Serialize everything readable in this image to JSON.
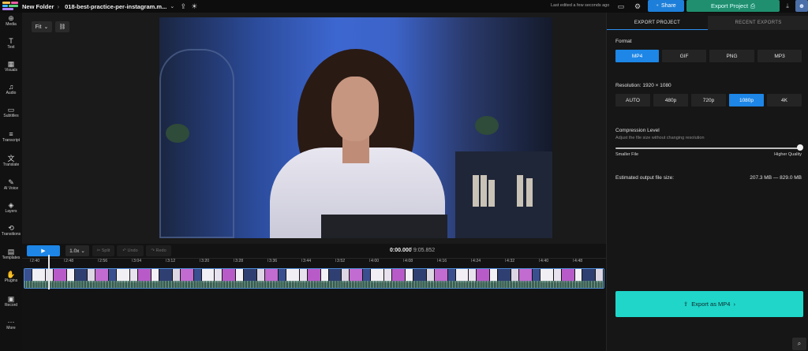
{
  "topbar": {
    "folder": "New Folder",
    "file": "018-best-practice-per-instagram.m...",
    "last_edited": "Last edited a few seconds ago",
    "share_label": "Share",
    "export_project_label": "Export Project"
  },
  "sidebar": {
    "items": [
      {
        "label": "Media",
        "icon": "media-icon",
        "glyph": "⊕"
      },
      {
        "label": "Text",
        "icon": "text-icon",
        "glyph": "T"
      },
      {
        "label": "Visuals",
        "icon": "visuals-icon",
        "glyph": "▦"
      },
      {
        "label": "Audio",
        "icon": "audio-icon",
        "glyph": "♫"
      },
      {
        "label": "Subtitles",
        "icon": "subtitles-icon",
        "glyph": "▭"
      },
      {
        "label": "Transcript",
        "icon": "transcript-icon",
        "glyph": "≡"
      },
      {
        "label": "Translate",
        "icon": "translate-icon",
        "glyph": "文"
      },
      {
        "label": "AI Voice",
        "icon": "ai-voice-icon",
        "glyph": "✎"
      },
      {
        "label": "Layers",
        "icon": "layers-icon",
        "glyph": "◈"
      },
      {
        "label": "Transitions",
        "icon": "transitions-icon",
        "glyph": "⟲"
      },
      {
        "label": "Templates",
        "icon": "templates-icon",
        "glyph": "▤"
      },
      {
        "label": "Plugins",
        "icon": "plugins-icon",
        "glyph": "✋"
      },
      {
        "label": "Record",
        "icon": "record-icon",
        "glyph": "▣"
      },
      {
        "label": "More",
        "icon": "more-icon",
        "glyph": "⋯"
      }
    ]
  },
  "canvas": {
    "fit_label": "Fit"
  },
  "export_panel": {
    "tabs": [
      "EXPORT PROJECT",
      "RECENT EXPORTS"
    ],
    "format_label": "Format",
    "formats": [
      "MP4",
      "GIF",
      "PNG",
      "MP3"
    ],
    "selected_format": "MP4",
    "resolution_label": "Resolution:",
    "resolution_value": "1920 × 1080",
    "resolutions": [
      "AUTO",
      "480p",
      "720p",
      "1080p",
      "4K"
    ],
    "selected_resolution": "1080p",
    "compression_label": "Compression Level",
    "compression_hint": "Adjust the file size without changing resolution",
    "compression_level": 0.99,
    "smaller_label": "Smaller File",
    "higher_label": "Higher Quality",
    "estimate_label": "Estimated output file size:",
    "estimate_value": "207.3 MB — 829.0 MB",
    "export_button": "Export as MP4"
  },
  "timeline": {
    "play_label": "▶",
    "speed": "1.0x",
    "split_label": "✂ Split",
    "undo_label": "↶ Undo",
    "redo_label": "↷ Redo",
    "current_time": "0:00.000",
    "total_time": "/ 9:05.852",
    "ticks": [
      "2:40",
      "2:48",
      "2:56",
      "3:04",
      "3:12",
      "3:20",
      "3:28",
      "3:36",
      "3:44",
      "3:52",
      "4:00",
      "4:08",
      "4:16",
      "4:24",
      "4:32",
      "4:40",
      "4:48"
    ]
  },
  "colors": {
    "accent": "#1d86e6",
    "export_teal": "#1fd6c9",
    "export_project": "#1f8f6f"
  }
}
